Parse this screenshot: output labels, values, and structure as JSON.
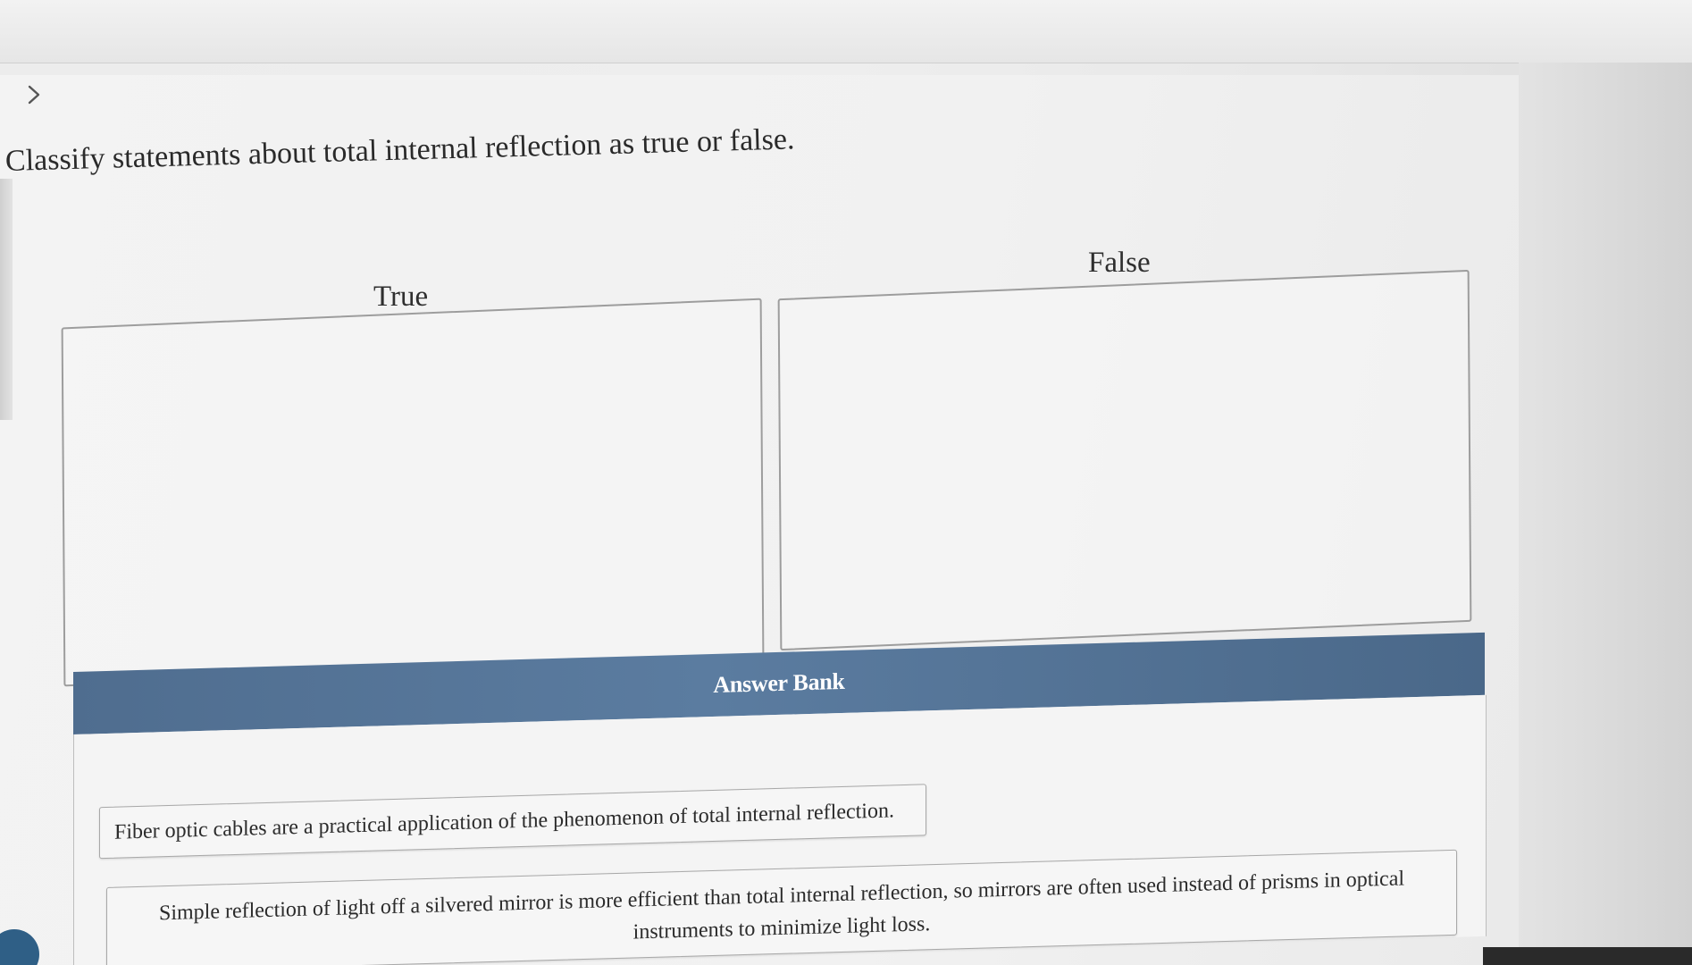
{
  "question": {
    "text": "Classify statements about total internal reflection as true or false."
  },
  "columns": {
    "true_label": "True",
    "false_label": "False"
  },
  "answer_bank": {
    "title": "Answer Bank",
    "items": [
      {
        "text": "Fiber optic cables are a practical application of the phenomenon of total internal reflection."
      },
      {
        "text": "Simple reflection of light off a silvered mirror is more efficient than total internal reflection, so mirrors are often used instead of prisms in optical instruments to minimize light loss."
      }
    ]
  },
  "icons": {
    "expand": "chevron-right-icon"
  },
  "colors": {
    "bank_header": "#587899",
    "bank_header_text": "#ffffff",
    "page_background": "#f1f1f1"
  }
}
